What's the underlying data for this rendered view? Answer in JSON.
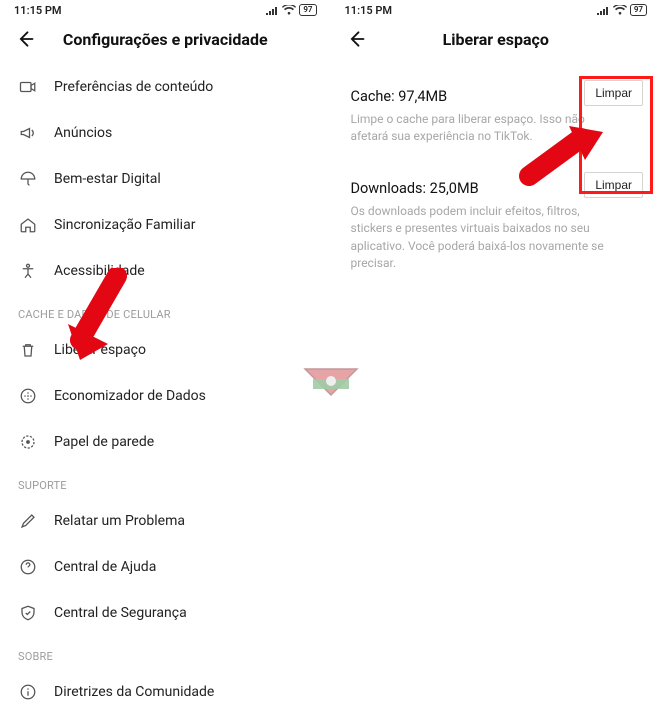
{
  "status": {
    "time": "11:15 PM",
    "battery": "97"
  },
  "left": {
    "title": "Configurações e privacidade",
    "rows1": [
      {
        "label": "Preferências de conteúdo"
      },
      {
        "label": "Anúncios"
      },
      {
        "label": "Bem-estar Digital"
      },
      {
        "label": "Sincronização Familiar"
      },
      {
        "label": "Acessibilidade"
      }
    ],
    "section_cache": "CACHE E DADOS DE CELULAR",
    "rows2": [
      {
        "label": "Liberar espaço"
      },
      {
        "label": "Economizador de Dados"
      },
      {
        "label": "Papel de parede"
      }
    ],
    "section_support": "SUPORTE",
    "rows3": [
      {
        "label": "Relatar um Problema"
      },
      {
        "label": "Central de Ajuda"
      },
      {
        "label": "Central de Segurança"
      }
    ],
    "section_about": "SOBRE",
    "rows4": [
      {
        "label": "Diretrizes da Comunidade"
      }
    ]
  },
  "right": {
    "title": "Liberar espaço",
    "cache_title": "Cache: 97,4MB",
    "cache_desc": "Limpe o cache para liberar espaço. Isso não afetará sua experiência no TikTok.",
    "downloads_title": "Downloads: 25,0MB",
    "downloads_desc": "Os downloads podem incluir efeitos, filtros, stickers e presentes virtuais baixados no seu aplicativo. Você poderá baixá-los novamente se precisar.",
    "clear_label": "Limpar"
  }
}
